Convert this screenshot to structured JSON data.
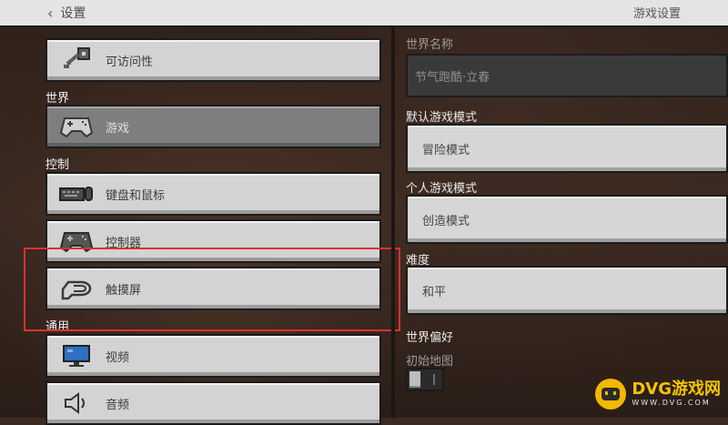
{
  "header": {
    "back_label": "设置",
    "page_title": "游戏设置"
  },
  "sidebar": {
    "items": [
      {
        "label": "可访问性",
        "icon": "key-icon",
        "active": false
      },
      {
        "label": "游戏",
        "icon": "gamepad-icon",
        "active": true
      },
      {
        "label": "键盘和鼠标",
        "icon": "keyboard-mouse-icon",
        "active": false
      },
      {
        "label": "控制器",
        "icon": "controller-icon",
        "active": false
      },
      {
        "label": "触摸屏",
        "icon": "touch-hand-icon",
        "active": false
      },
      {
        "label": "视频",
        "icon": "monitor-icon",
        "active": false
      },
      {
        "label": "音频",
        "icon": "speaker-icon",
        "active": false
      }
    ],
    "sections": [
      "世界",
      "控制",
      "通用"
    ]
  },
  "settings": {
    "world_name_label": "世界名称",
    "world_name_value": "节气跑酷·立春",
    "default_mode_label": "默认游戏模式",
    "default_mode_value": "冒险模式",
    "personal_mode_label": "个人游戏模式",
    "personal_mode_value": "创造模式",
    "difficulty_label": "难度",
    "difficulty_value": "和平",
    "world_prefs_label": "世界偏好",
    "starter_map_label": "初始地图",
    "starter_map_on": false
  },
  "watermark": {
    "title": "DVG游戏网",
    "subtitle": "WWW.DVG.COM"
  },
  "colors": {
    "highlight": "#d9322e",
    "logo": "#f5b800"
  }
}
